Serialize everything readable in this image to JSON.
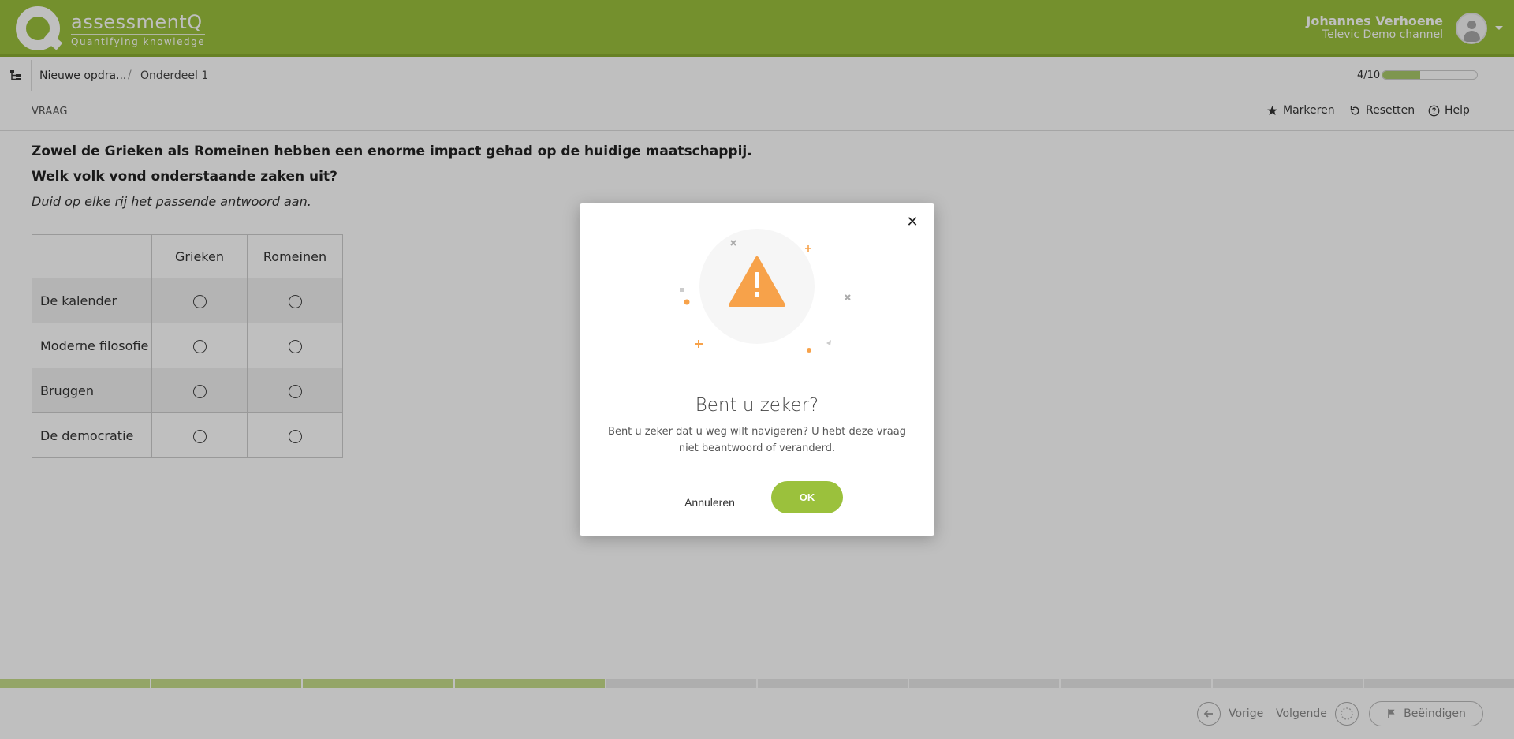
{
  "header": {
    "brand": "assessmentQ",
    "tagline": "Quantifying knowledge",
    "user_name": "Johannes Verhoene",
    "user_channel": "Televic Demo channel"
  },
  "breadcrumb": {
    "item1": "Nieuwe opdra...",
    "separator": "/",
    "item2": "Onderdeel 1"
  },
  "progress": {
    "label": "4/10",
    "current": 4,
    "total": 10
  },
  "question_toolbar": {
    "label": "VRAAG",
    "mark": "Markeren",
    "reset": "Resetten",
    "help": "Help"
  },
  "question": {
    "line1": "Zowel de Grieken als Romeinen hebben een enorme impact gehad op de huidige maatschappij.",
    "line2": "Welk volk vond onderstaande zaken uit?",
    "instruction": "Duid op elke rij het passende antwoord aan.",
    "columns": [
      "",
      "Grieken",
      "Romeinen"
    ],
    "rows": [
      "De kalender",
      "Moderne filosofie",
      "Bruggen",
      "De democratie"
    ]
  },
  "segments": {
    "done": 4,
    "total": 10
  },
  "footer": {
    "prev": "Vorige",
    "next": "Volgende",
    "finish": "Beëindigen"
  },
  "modal": {
    "title": "Bent u zeker?",
    "message": "Bent u zeker dat u weg wilt navigeren? U hebt deze vraag niet beantwoord of veranderd.",
    "cancel": "Annuleren",
    "ok": "OK"
  },
  "colors": {
    "brand_green": "#9bc13c",
    "warning_orange": "#f7a24a"
  }
}
